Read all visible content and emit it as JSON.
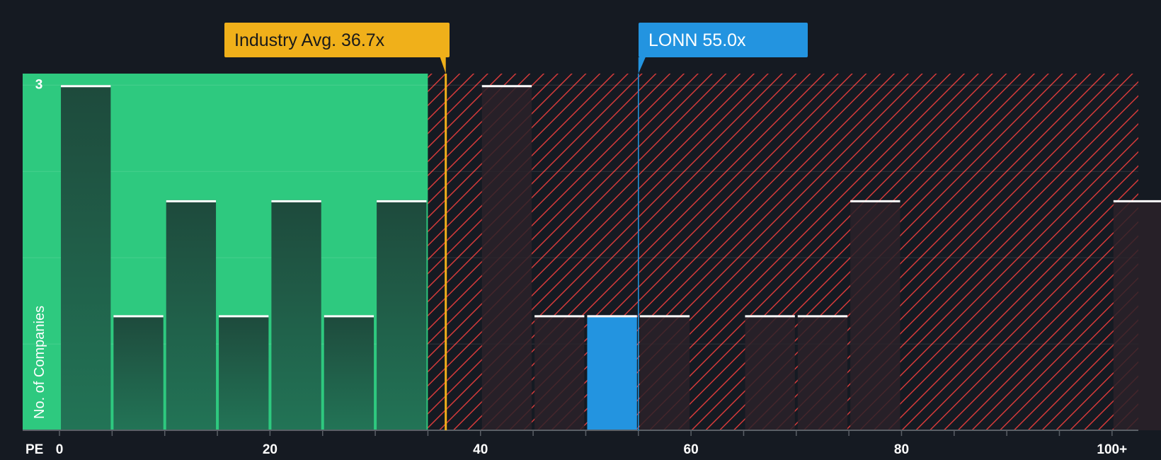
{
  "chart_data": {
    "type": "bar",
    "xlabel": "PE",
    "ylabel": "No. of Companies",
    "bin_width": 5,
    "x_ticks": [
      {
        "value": 0,
        "label": "0"
      },
      {
        "value": 20,
        "label": "20"
      },
      {
        "value": 40,
        "label": "40"
      },
      {
        "value": 60,
        "label": "60"
      },
      {
        "value": 80,
        "label": "80"
      },
      {
        "value": 100,
        "label": "100+"
      }
    ],
    "y_ticks": [
      {
        "value": 3,
        "label": "3"
      }
    ],
    "ylim": [
      0,
      3.1
    ],
    "xlim": [
      -3.5,
      102.5
    ],
    "bins": [
      {
        "start": 0,
        "count": 3
      },
      {
        "start": 5,
        "count": 1
      },
      {
        "start": 10,
        "count": 2
      },
      {
        "start": 15,
        "count": 1
      },
      {
        "start": 20,
        "count": 2
      },
      {
        "start": 25,
        "count": 1
      },
      {
        "start": 30,
        "count": 2
      },
      {
        "start": 40,
        "count": 3
      },
      {
        "start": 45,
        "count": 1
      },
      {
        "start": 50,
        "count": 1,
        "highlight": true
      },
      {
        "start": 55,
        "count": 1
      },
      {
        "start": 65,
        "count": 1
      },
      {
        "start": 70,
        "count": 1
      },
      {
        "start": 75,
        "count": 2
      },
      {
        "start": 100,
        "count": 2
      }
    ],
    "industry_avg": {
      "value": 36.7,
      "label": "Industry Avg. 36.7x"
    },
    "company": {
      "value": 55.0,
      "label": "LONN 55.0x"
    },
    "fair_zone_end": 35,
    "colors": {
      "background": "#151a22",
      "fair_zone": "#2ec97f",
      "over_zone_stripe": "#d43a3a",
      "industry_avg": "#f0b01a",
      "company": "#2394e0",
      "bar_in_fair": "#1f4a3e",
      "bar_in_over": "#2a2229",
      "bar_cap": "#ffffff",
      "axis_text": "#ffffff"
    }
  }
}
